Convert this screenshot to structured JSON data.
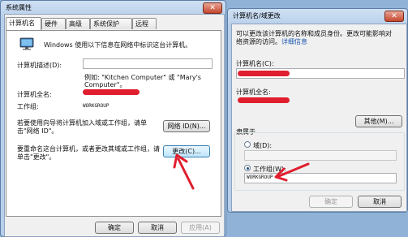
{
  "left_window": {
    "title": "系统属性",
    "tabs": [
      "计算机名",
      "硬件",
      "高级",
      "系统保护",
      "远程"
    ],
    "intro": "Windows 使用以下信息在网络中标识这台计算机。",
    "description_label": "计算机描述(D):",
    "description_value": "",
    "example_line1": "例如: \"Kitchen Computer\" 或 \"Mary's",
    "example_line2": "Computer\"。",
    "full_name_label": "计算机全名:",
    "workgroup_label": "工作组:",
    "workgroup_value": "WORKGROUP",
    "wizard_text_line1": "若要使用向导将计算机加入域或工作组，请单",
    "wizard_text_line2": "击\"网络 ID\"。",
    "network_id_button": "网络 ID(N)...",
    "rename_text_line1": "要重命名这台计算机，或者更改其域或工作组，请",
    "rename_text_line2": "单击\"更改\"。",
    "change_button": "更改(C)...",
    "ok_button": "确定",
    "cancel_button": "取消",
    "apply_button": "应用(A)"
  },
  "right_window": {
    "title": "计算机名/域更改",
    "intro_line1": "可以更改该计算机的名称和成员身份。更改可能影响对",
    "intro_line2": "络资源的访问。",
    "more_info_link": "详细信息",
    "name_label": "计算机名(C):",
    "full_name_label": "计算机全名:",
    "other_button": "其他(M)...",
    "member_of_label": "隶属于",
    "domain_option": "域(D):",
    "workgroup_option": "工作组(W):",
    "workgroup_value": "WORKGROUP",
    "ok_button": "确定",
    "cancel_button": "取消"
  },
  "colors": {
    "annotation_red": "#e01e2e"
  }
}
